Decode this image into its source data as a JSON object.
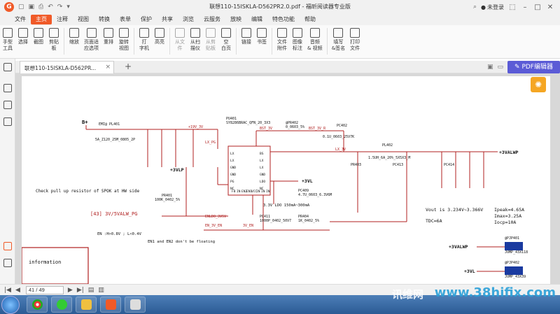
{
  "app": {
    "title": "联想110-15ISKLA-D562PR2.0.pdf - 福昕阅读器专业版",
    "login": "未登录"
  },
  "menu": [
    "文件",
    "主页",
    "注释",
    "视图",
    "转换",
    "表单",
    "保护",
    "共享",
    "浏览",
    "云服务",
    "放映",
    "编辑",
    "特色功能",
    "帮助"
  ],
  "menu_active": "主页",
  "ribbon": [
    {
      "name": "hand-tool",
      "label": "手型\n工具"
    },
    {
      "name": "select",
      "label": "选择"
    },
    {
      "name": "screenshot",
      "label": "截图"
    },
    {
      "name": "clipboard",
      "label": "剪贴\n板"
    },
    {
      "name": "zoom",
      "label": "缩放"
    },
    {
      "name": "fit-page",
      "label": "页面适\n应选项"
    },
    {
      "name": "reflow",
      "label": "重排"
    },
    {
      "name": "rotate-view",
      "label": "旋转\n视图"
    },
    {
      "name": "typewriter",
      "label": "打\n字机"
    },
    {
      "name": "highlight",
      "label": "高亮"
    },
    {
      "name": "from-file",
      "label": "从文\n件",
      "dim": true
    },
    {
      "name": "from-scanner",
      "label": "从扫\n描仪"
    },
    {
      "name": "from-clipboard",
      "label": "从剪\n贴板",
      "dim": true
    },
    {
      "name": "blank-page",
      "label": "空\n白页"
    },
    {
      "name": "link",
      "label": "链接"
    },
    {
      "name": "bookmark",
      "label": "书签"
    },
    {
      "name": "file-attachment",
      "label": "文件\n附件"
    },
    {
      "name": "image-annotation",
      "label": "图像\n标注"
    },
    {
      "name": "audio-video",
      "label": "音频\n& 视频"
    },
    {
      "name": "fill-sign",
      "label": "填写\n&签名"
    },
    {
      "name": "print-file",
      "label": "打印\n文件"
    }
  ],
  "tab": {
    "label": "联想110-15ISKLA-D562PR...",
    "add": "+"
  },
  "pdf_editor_label": "PDF编辑器",
  "status": {
    "page_value": "41 / 49"
  },
  "watermark": {
    "brand": "讯维网",
    "url": "www.38hifix.com"
  },
  "schematic": {
    "b_plus": "B+",
    "emi": "EMI@  PL401",
    "l401": "5A_Z120_25M_0805_2P",
    "plus19v": "+19V_3V",
    "lx_pg": "LX_PG",
    "pu401": "PU401",
    "pu401b": "SY8286BRAC_QFN_20_3X3",
    "bst": "BST_3V",
    "pr402": "@PR402",
    "pr402b": "0_0603_5%",
    "bst_r": "BST_3V_R",
    "pc402": "PC402",
    "pc402b": "0.1U_0603_25V7K",
    "pl402": "PL402",
    "pl402b": "1.5UH_6A_20%_5X5X3_M",
    "lx3v": "LX_3V",
    "out_3valwp": "+3VALWP",
    "p3vlp": "+3VLP",
    "p3vl": "+3VL",
    "check_note": "Check pull up resistor of SPOK at HW side",
    "pr401": "PR401",
    "pr401b": "100K_0402_5%",
    "sig43": "[43]  3V/5VALW_PG",
    "pc409": "PC409",
    "pc409b": "4.7U_0603_6.3V6M",
    "v33": "3.3V  LDO  150mA~300mA",
    "vout": "Vout is 3.234V~3.366V",
    "ipeak": "Ipeak=4.65A",
    "imax": "Imax=3.25A",
    "iocp": "Iocp=10A",
    "tdc": "TDC=6A",
    "en_note": "EN :H>0.8V   ; L<0.4V",
    "en_note2": "EN1 and EN2 don't be floating",
    "en_3vaw": "EN_3V_EN",
    "en_bvp": "ENLDO_3V5V",
    "en_3v_en": "3V_EN",
    "pc411": "PC411",
    "pc411b": "1000P_0402_50V7",
    "pr404": "PR404",
    "pr404b": "1K_0402_5%",
    "ic_pins": [
      "LX",
      "LX",
      "GND",
      "GND",
      "PG",
      "NC",
      "BS",
      "LX",
      "LX",
      "GND",
      "LDO",
      "NC",
      "FB",
      "IN",
      "EN2",
      "EN1",
      "VCC",
      "IN",
      "IN",
      "IN"
    ],
    "info_label": "information",
    "jp_top": "@PJP401",
    "jp_top_b": "JUMP_43X118",
    "jp_bot": "@PJP402",
    "jp_bot_b": "JUMP_43X39",
    "rail_3valwp": "+3VALWP",
    "rail_3vl": "+3VL",
    "pr403": "PR403",
    "pc413": "PC413",
    "pc414": "PC414"
  }
}
